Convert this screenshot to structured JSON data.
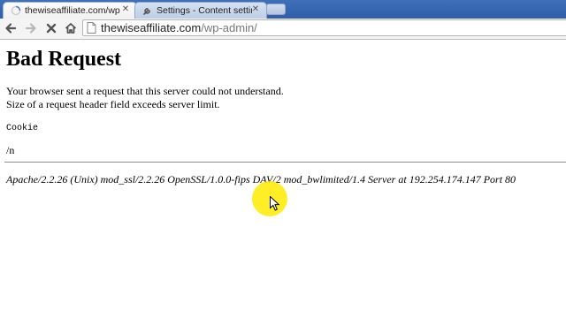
{
  "browser": {
    "tabs": [
      {
        "title": "thewiseaffiliate.com/wp-a",
        "active": true,
        "icon": "loading-spinner-icon"
      },
      {
        "title": "Settings - Content setting",
        "active": false,
        "icon": "wrench-icon"
      }
    ],
    "toolbar": {
      "back_icon": "arrow-left-icon",
      "forward_icon": "arrow-right-icon",
      "stop_icon": "close-icon",
      "home_icon": "home-icon",
      "address": {
        "domain": "thewiseaffiliate.com",
        "path": "/wp-admin/",
        "icon": "page-icon"
      }
    }
  },
  "page": {
    "heading": "Bad Request",
    "message_line1": "Your browser sent a request that this server could not understand.",
    "message_line2": "Size of a request header field exceeds server limit.",
    "header_name": "Cookie",
    "header_value": "/n",
    "server_signature": "Apache/2.2.26 (Unix) mod_ssl/2.2.26 OpenSSL/1.0.0-fips DAV/2 mod_bwlimited/1.4 Server at 192.254.174.147 Port 80"
  },
  "colors": {
    "tabstrip": "#3565b0",
    "cursor_highlight": "#ffea00"
  }
}
